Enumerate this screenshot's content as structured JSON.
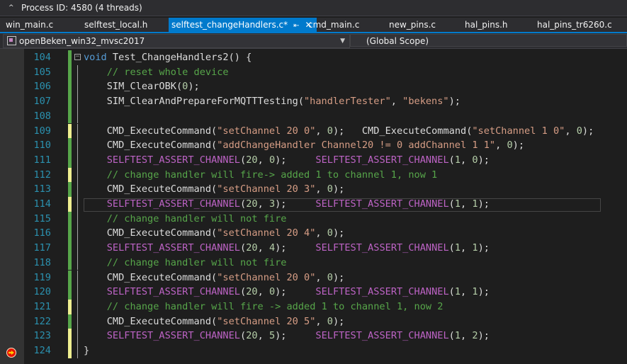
{
  "process": {
    "caret": "^",
    "label": "Process ID: 4580  (4 threads)"
  },
  "tabs": [
    {
      "label": "win_main.c",
      "active": false
    },
    {
      "label": "selftest_local.h",
      "active": false
    },
    {
      "label": "selftest_changeHandlers.c*",
      "active": true
    },
    {
      "label": "cmd_main.c",
      "active": false
    },
    {
      "label": "new_pins.c",
      "active": false
    },
    {
      "label": "hal_pins.h",
      "active": false
    },
    {
      "label": "hal_pins_tr6260.c",
      "active": false
    }
  ],
  "nav": {
    "project": "openBeken_win32_mvsc2017",
    "scope": "(Global Scope)"
  },
  "icons": {
    "pin": "pin-icon",
    "close": "close-icon",
    "breakpoint": "breakpoint-current-statement-icon",
    "outline": "outline-collapse-icon"
  },
  "colors": {
    "accent": "#007acc",
    "keyword": "#569cd6",
    "string": "#d69d85",
    "comment": "#57a64a",
    "macro": "#bd63c5",
    "linenum": "#2b91af"
  },
  "lines": [
    {
      "num": "104",
      "segs": [
        [
          "k",
          "void"
        ],
        [
          "p",
          " Test_ChangeHandlers2() {"
        ]
      ]
    },
    {
      "num": "105",
      "segs": [
        [
          "p",
          "    "
        ],
        [
          "c",
          "// reset whole device"
        ]
      ]
    },
    {
      "num": "106",
      "segs": [
        [
          "p",
          "    SIM_ClearOBK("
        ],
        [
          "n",
          "0"
        ],
        [
          "p",
          ");"
        ]
      ]
    },
    {
      "num": "107",
      "segs": [
        [
          "p",
          "    SIM_ClearAndPrepareForMQTTTesting("
        ],
        [
          "s",
          "\"handlerTester\""
        ],
        [
          "p",
          ", "
        ],
        [
          "s",
          "\"bekens\""
        ],
        [
          "p",
          ");"
        ]
      ]
    },
    {
      "num": "108",
      "segs": []
    },
    {
      "num": "109",
      "segs": [
        [
          "p",
          "    CMD_ExecuteCommand("
        ],
        [
          "s",
          "\"setChannel 20 0\""
        ],
        [
          "p",
          ", "
        ],
        [
          "n",
          "0"
        ],
        [
          "p",
          ");   CMD_ExecuteCommand("
        ],
        [
          "s",
          "\"setChannel 1 0\""
        ],
        [
          "p",
          ", "
        ],
        [
          "n",
          "0"
        ],
        [
          "p",
          ");"
        ]
      ]
    },
    {
      "num": "110",
      "segs": [
        [
          "p",
          "    CMD_ExecuteCommand("
        ],
        [
          "s",
          "\"addChangeHandler Channel20 != 0 addChannel 1 1\""
        ],
        [
          "p",
          ", "
        ],
        [
          "n",
          "0"
        ],
        [
          "p",
          ");"
        ]
      ]
    },
    {
      "num": "111",
      "segs": [
        [
          "p",
          "    "
        ],
        [
          "m",
          "SELFTEST_ASSERT_CHANNEL"
        ],
        [
          "p",
          "("
        ],
        [
          "n",
          "20"
        ],
        [
          "p",
          ", "
        ],
        [
          "n",
          "0"
        ],
        [
          "p",
          ");     "
        ],
        [
          "m",
          "SELFTEST_ASSERT_CHANNEL"
        ],
        [
          "p",
          "("
        ],
        [
          "n",
          "1"
        ],
        [
          "p",
          ", "
        ],
        [
          "n",
          "0"
        ],
        [
          "p",
          ");"
        ]
      ]
    },
    {
      "num": "112",
      "segs": [
        [
          "p",
          "    "
        ],
        [
          "c",
          "// change handler will fire-> added 1 to channel 1, now 1"
        ]
      ]
    },
    {
      "num": "113",
      "segs": [
        [
          "p",
          "    CMD_ExecuteCommand("
        ],
        [
          "s",
          "\"setChannel 20 3\""
        ],
        [
          "p",
          ", "
        ],
        [
          "n",
          "0"
        ],
        [
          "p",
          ");"
        ]
      ]
    },
    {
      "num": "114",
      "segs": [
        [
          "p",
          "    "
        ],
        [
          "m",
          "SELFTEST_ASSERT_CHANNEL"
        ],
        [
          "p",
          "("
        ],
        [
          "n",
          "20"
        ],
        [
          "p",
          ", "
        ],
        [
          "n",
          "3"
        ],
        [
          "p",
          ");     "
        ],
        [
          "m",
          "SELFTEST_ASSERT_CHANNEL"
        ],
        [
          "p",
          "("
        ],
        [
          "n",
          "1"
        ],
        [
          "p",
          ", "
        ],
        [
          "n",
          "1"
        ],
        [
          "p",
          ");"
        ]
      ]
    },
    {
      "num": "115",
      "segs": [
        [
          "p",
          "    "
        ],
        [
          "c",
          "// change handler will not fire"
        ]
      ]
    },
    {
      "num": "116",
      "segs": [
        [
          "p",
          "    CMD_ExecuteCommand("
        ],
        [
          "s",
          "\"setChannel 20 4\""
        ],
        [
          "p",
          ", "
        ],
        [
          "n",
          "0"
        ],
        [
          "p",
          ");"
        ]
      ]
    },
    {
      "num": "117",
      "segs": [
        [
          "p",
          "    "
        ],
        [
          "m",
          "SELFTEST_ASSERT_CHANNEL"
        ],
        [
          "p",
          "("
        ],
        [
          "n",
          "20"
        ],
        [
          "p",
          ", "
        ],
        [
          "n",
          "4"
        ],
        [
          "p",
          ");     "
        ],
        [
          "m",
          "SELFTEST_ASSERT_CHANNEL"
        ],
        [
          "p",
          "("
        ],
        [
          "n",
          "1"
        ],
        [
          "p",
          ", "
        ],
        [
          "n",
          "1"
        ],
        [
          "p",
          ");"
        ]
      ]
    },
    {
      "num": "118",
      "segs": [
        [
          "p",
          "    "
        ],
        [
          "c",
          "// change handler will not fire"
        ]
      ]
    },
    {
      "num": "119",
      "segs": [
        [
          "p",
          "    CMD_ExecuteCommand("
        ],
        [
          "s",
          "\"setChannel 20 0\""
        ],
        [
          "p",
          ", "
        ],
        [
          "n",
          "0"
        ],
        [
          "p",
          ");"
        ]
      ]
    },
    {
      "num": "120",
      "segs": [
        [
          "p",
          "    "
        ],
        [
          "m",
          "SELFTEST_ASSERT_CHANNEL"
        ],
        [
          "p",
          "("
        ],
        [
          "n",
          "20"
        ],
        [
          "p",
          ", "
        ],
        [
          "n",
          "0"
        ],
        [
          "p",
          ");     "
        ],
        [
          "m",
          "SELFTEST_ASSERT_CHANNEL"
        ],
        [
          "p",
          "("
        ],
        [
          "n",
          "1"
        ],
        [
          "p",
          ", "
        ],
        [
          "n",
          "1"
        ],
        [
          "p",
          ");"
        ]
      ]
    },
    {
      "num": "121",
      "segs": [
        [
          "p",
          "    "
        ],
        [
          "c",
          "// change handler will fire -> added 1 to channel 1, now 2"
        ]
      ]
    },
    {
      "num": "122",
      "segs": [
        [
          "p",
          "    CMD_ExecuteCommand("
        ],
        [
          "s",
          "\"setChannel 20 5\""
        ],
        [
          "p",
          ", "
        ],
        [
          "n",
          "0"
        ],
        [
          "p",
          ");"
        ]
      ]
    },
    {
      "num": "123",
      "segs": [
        [
          "p",
          "    "
        ],
        [
          "m",
          "SELFTEST_ASSERT_CHANNEL"
        ],
        [
          "p",
          "("
        ],
        [
          "n",
          "20"
        ],
        [
          "p",
          ", "
        ],
        [
          "n",
          "5"
        ],
        [
          "p",
          ");     "
        ],
        [
          "m",
          "SELFTEST_ASSERT_CHANNEL"
        ],
        [
          "p",
          "("
        ],
        [
          "n",
          "1"
        ],
        [
          "p",
          ", "
        ],
        [
          "n",
          "2"
        ],
        [
          "p",
          ");"
        ]
      ]
    },
    {
      "num": "124",
      "segs": [
        [
          "p",
          "}"
        ]
      ]
    }
  ],
  "unsaved_lines": [
    "109",
    "112",
    "114",
    "121",
    "123",
    "124"
  ],
  "current_line": "114",
  "breakpoint_line": "124"
}
